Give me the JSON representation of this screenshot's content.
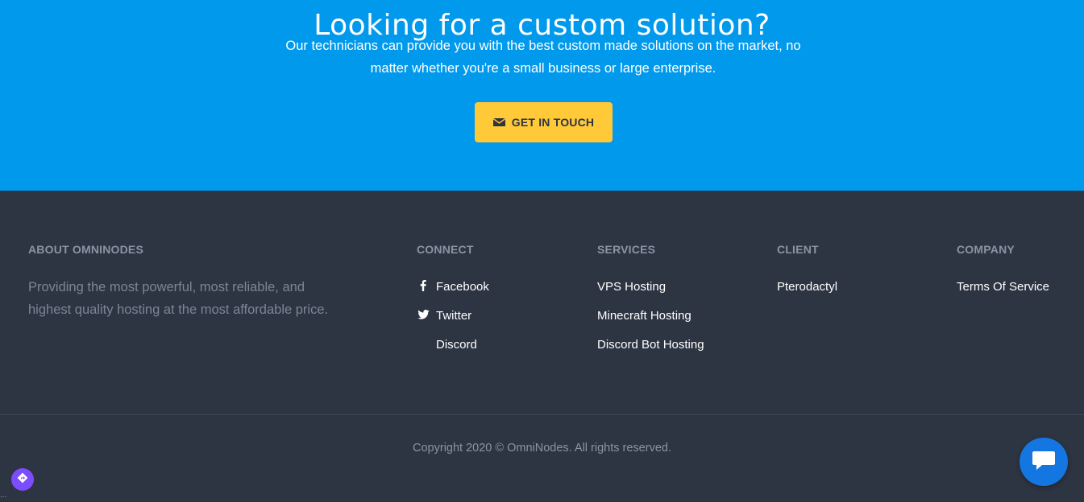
{
  "cta": {
    "title": "Looking for a custom solution?",
    "description": "Our technicians can provide you with the best custom made solutions on the market, no matter whether you're a small business or large enterprise.",
    "button_label": "GET IN TOUCH",
    "button_icon": "envelope-icon",
    "background_color": "#0099ec",
    "button_color": "#ffc937"
  },
  "footer": {
    "about": {
      "title": "ABOUT OMNINODES",
      "text": "Providing the most powerful, most reliable, and highest quality hosting at the most affordable price."
    },
    "connect": {
      "title": "CONNECT",
      "items": [
        {
          "label": "Facebook",
          "icon": "facebook-icon"
        },
        {
          "label": "Twitter",
          "icon": "twitter-icon"
        },
        {
          "label": "Discord",
          "icon": "discord-icon"
        }
      ]
    },
    "services": {
      "title": "SERVICES",
      "items": [
        "VPS Hosting",
        "Minecraft Hosting",
        "Discord Bot Hosting"
      ]
    },
    "client": {
      "title": "CLIENT",
      "items": [
        "Pterodactyl"
      ]
    },
    "company": {
      "title": "COMPANY",
      "items": [
        "Terms Of Service"
      ]
    },
    "copyright": "Copyright 2020 © OmniNodes. All rights reserved.",
    "background_color": "#2d3442"
  },
  "chat": {
    "icon": "chat-icon",
    "color": "#1476e0"
  },
  "nav_widget": {
    "icon": "direction-icon",
    "color": "#7b4dff"
  },
  "corner_text": "..."
}
